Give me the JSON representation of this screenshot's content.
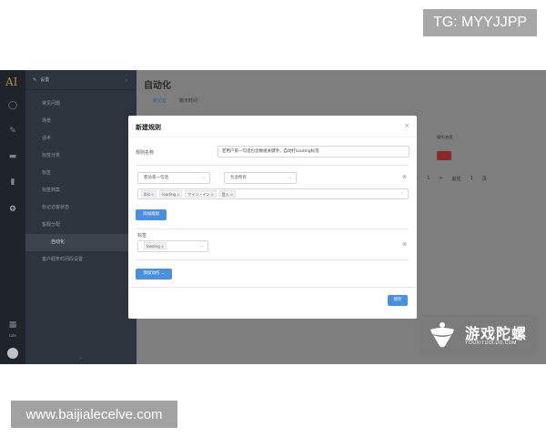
{
  "overlay": {
    "tg_text": "TG: MYYJJPP",
    "url_text": "www.baijialecelve.com"
  },
  "icon_rail": {
    "logo": "AI",
    "icons": [
      "circle-icon",
      "wrench-icon",
      "message-icon",
      "chart-icon",
      "gear-icon"
    ],
    "user_label": "tate"
  },
  "sidebar": {
    "header": "设置",
    "items": [
      {
        "label": "常见问题"
      },
      {
        "label": "场景"
      },
      {
        "label": "话术"
      },
      {
        "label": "标签分类"
      },
      {
        "label": "标签"
      },
      {
        "label": "标签档案"
      },
      {
        "label": "标记访客状态"
      },
      {
        "label": "客服分配"
      },
      {
        "label": "自动化",
        "active": true
      },
      {
        "label": "客户服务时间段设置"
      }
    ]
  },
  "main": {
    "title": "自动化",
    "tabs": [
      {
        "label": "新访客",
        "active": true
      },
      {
        "label": "聊天时间"
      }
    ],
    "table_action_label": "操作/启用",
    "pager_items": [
      "<",
      "1",
      ">",
      "前往",
      "1",
      "页"
    ]
  },
  "modal": {
    "title": "新建规则",
    "close_symbol": "×",
    "rule_name_label": "规则名称",
    "rule_name_value": "若用户第一句话包含数组关键字，自动打loading标签",
    "condition": {
      "left_select": "客访第一句话",
      "right_select": "包含所有",
      "tags": [
        "Ibis",
        "loading",
        "サイン・イン",
        "登入"
      ]
    },
    "add_condition_button": "添加规则",
    "action_label": "标签",
    "action_tag": "loading",
    "add_action_button": "添加动作",
    "save_button": "保存"
  },
  "watermark": {
    "title": "游戏陀螺",
    "subtitle": "YOUXITUOLUO.COM"
  }
}
